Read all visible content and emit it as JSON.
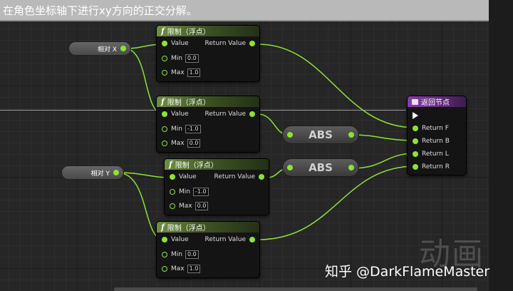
{
  "comment": "在角色坐标轴下进行xy方向的正交分解。",
  "variables": {
    "x": "相对 X",
    "y": "相对 Y"
  },
  "clamp_nodes": [
    {
      "title": "限制（浮点）",
      "in_label": "Value",
      "out_label": "Return Value",
      "min_label": "Min",
      "min": "0.0",
      "max_label": "Max",
      "max": "1.0"
    },
    {
      "title": "限制（浮点）",
      "in_label": "Value",
      "out_label": "Return Value",
      "min_label": "Min",
      "min": "-1.0",
      "max_label": "Max",
      "max": "0.0"
    },
    {
      "title": "限制（浮点）",
      "in_label": "Value",
      "out_label": "Return Value",
      "min_label": "Min",
      "min": "-1.0",
      "max_label": "Max",
      "max": "0.0"
    },
    {
      "title": "限制（浮点）",
      "in_label": "Value",
      "out_label": "Return Value",
      "min_label": "Min",
      "min": "0.0",
      "max_label": "Max",
      "max": "1.0"
    }
  ],
  "abs_nodes": [
    "ABS",
    "ABS"
  ],
  "return_node": {
    "title": "返回节点",
    "pins": [
      "Return F",
      "Return B",
      "Return L",
      "Return R"
    ]
  },
  "watermark": {
    "big": "动画",
    "credit": "知乎 @DarkFlameMaster"
  },
  "colors": {
    "wire": "#8de234",
    "clamp_header": "#6f8f44",
    "return_header": "#8a3fa8"
  }
}
